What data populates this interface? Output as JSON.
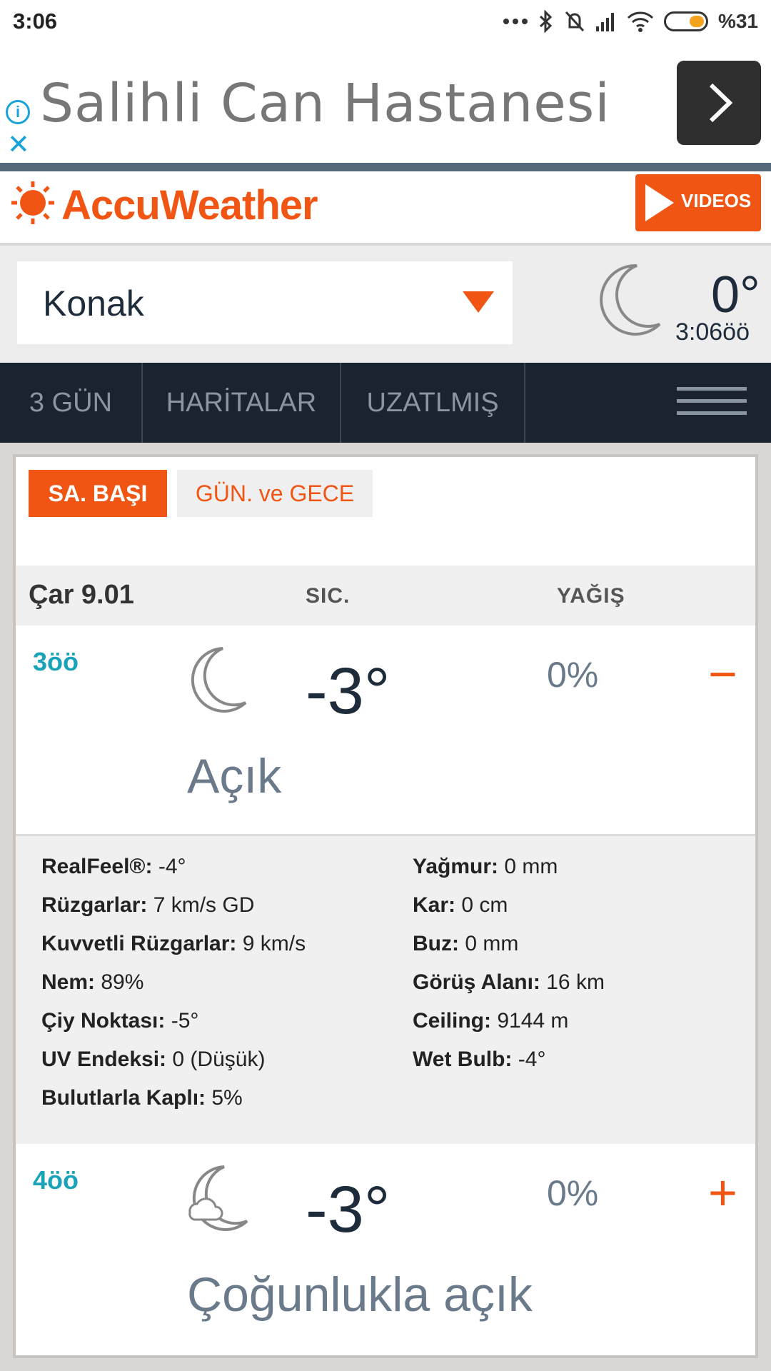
{
  "status_bar": {
    "time": "3:06",
    "battery": "%31"
  },
  "ad": {
    "title": "Salihli Can Hastanesi",
    "info_icon": "i"
  },
  "brand": {
    "name": "AccuWeather",
    "videos_label": "VIDEOS"
  },
  "location": {
    "name": "Konak",
    "current_temp": "0°",
    "current_time": "3:06öö"
  },
  "nav": {
    "tabs": [
      "3 GÜN",
      "HARİTALAR",
      "UZATLMIŞ"
    ]
  },
  "view_tabs": {
    "hourly": "SA. BAŞI",
    "day_night": "GÜN. ve GECE"
  },
  "table": {
    "date": "Çar 9.01",
    "temp_header": "SIC.",
    "precip_header": "YAĞIŞ"
  },
  "hours": [
    {
      "hour": "3öö",
      "temp": "-3°",
      "precip": "0%",
      "toggle": "−",
      "condition": "Açık",
      "icon": "moon-icon"
    },
    {
      "hour": "4öö",
      "temp": "-3°",
      "precip": "0%",
      "toggle": "+",
      "condition": "Çoğunlukla açık",
      "icon": "moon-cloud-icon"
    }
  ],
  "details": {
    "left": [
      {
        "label": "RealFeel®:",
        "value": " -4°"
      },
      {
        "label": "Rüzgarlar:",
        "value": " 7 km/s GD"
      },
      {
        "label": "Kuvvetli Rüzgarlar:",
        "value": " 9 km/s"
      },
      {
        "label": "Nem:",
        "value": " 89%"
      },
      {
        "label": "Çiy Noktası:",
        "value": " -5°"
      },
      {
        "label": "UV Endeksi:",
        "value": " 0 (Düşük)"
      },
      {
        "label": "Bulutlarla Kaplı:",
        "value": " 5%"
      }
    ],
    "right": [
      {
        "label": "Yağmur:",
        "value": " 0 mm"
      },
      {
        "label": "Kar:",
        "value": " 0 cm"
      },
      {
        "label": "Buz:",
        "value": " 0 mm"
      },
      {
        "label": "Görüş Alanı:",
        "value": " 16 km"
      },
      {
        "label": "Ceiling:",
        "value": " 9144 m"
      },
      {
        "label": "Wet Bulb:",
        "value": " -4°"
      }
    ]
  },
  "colors": {
    "accent": "#f05514",
    "nav_bg": "#1c2330",
    "hour_label": "#1aa3b8"
  }
}
